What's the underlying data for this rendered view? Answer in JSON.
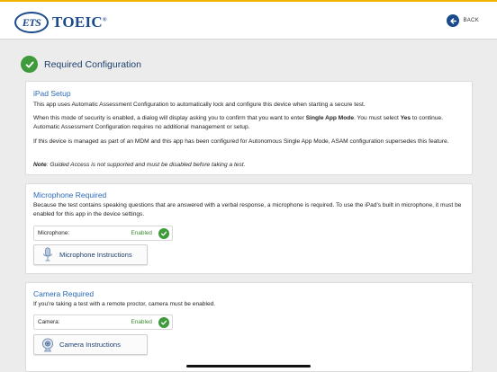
{
  "header": {
    "logo_ets": "ETS",
    "logo_brand": "TOEIC",
    "logo_registered": "®",
    "back_label": "BACK",
    "accent_color": "#f0b400",
    "brand_color": "#1b4a8c"
  },
  "page": {
    "title": "Required Configuration",
    "status_icon": "checkmark-circle-icon"
  },
  "ipad_setup": {
    "title": "iPad Setup",
    "p1": "This app uses Automatic Assessment Configuration to automatically lock and configure this device when starting a secure test.",
    "p2_a": "When this mode of security is enabled, a dialog will display asking you to confirm that you want to enter ",
    "p2_b": "Single App Mode",
    "p2_c": ". You must select ",
    "p2_d": "Yes",
    "p2_e": " to continue. Automatic Assessment Configuration requires no additional management or setup.",
    "p3": "If this device is managed as part of an MDM and this app has been configured for Autonomous Single App Mode, ASAM configuration supersedes this feature.",
    "note_label": "Note",
    "note_text": ": Guided Access is not supported and must be disabled before taking a test."
  },
  "microphone": {
    "title": "Microphone Required",
    "description": "Because the test contains speaking questions that are answered with a verbal response, a microphone is required. To use the iPad's built in microphone, it must be enabled for this app in the device settings.",
    "status_label": "Microphone:",
    "status_value": "Enabled",
    "button_label": "Microphone Instructions",
    "button_icon": "microphone-icon"
  },
  "camera": {
    "title": "Camera Required",
    "description": "If you're taking a test with a remote proctor, camera must be enabled.",
    "status_label": "Camera:",
    "status_value": "Enabled",
    "button_label": "Camera Instructions",
    "button_icon": "webcam-icon"
  },
  "colors": {
    "enabled_green": "#3e9a3a",
    "title_blue": "#2a6ab5"
  }
}
